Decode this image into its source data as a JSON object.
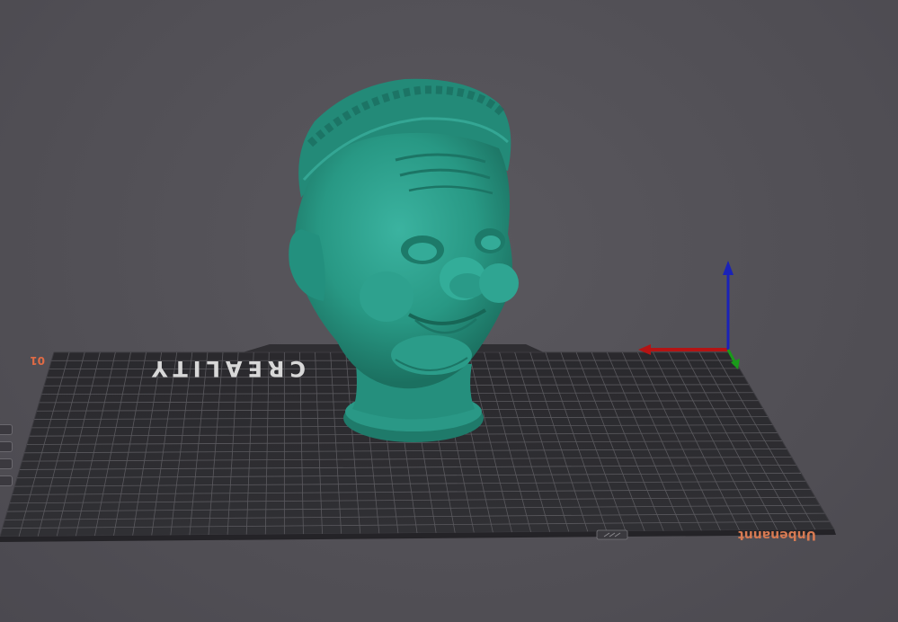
{
  "viewport": {
    "bed_brand": "CREALITY",
    "plate_name": "Unbenannt",
    "plate_index": "01"
  },
  "colors": {
    "background": "#535157",
    "bed": "#2b2a2e",
    "grid": "#6b6a6f",
    "model": "#2a9a88",
    "axis_x": "#c01818",
    "axis_y": "#1a9a1a",
    "axis_z": "#1a22c0"
  },
  "icons": {
    "model": "head-bust-model",
    "gizmo": "xyz-axes-gizmo",
    "plate_settings": "plate-settings-icon"
  }
}
